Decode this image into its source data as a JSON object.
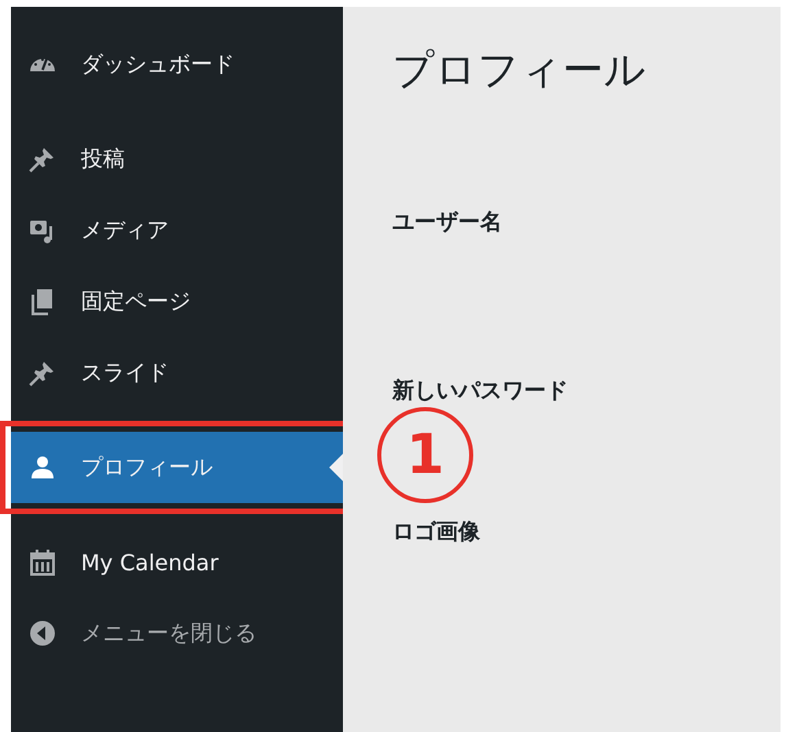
{
  "sidebar": {
    "groups": [
      [
        {
          "label": "ダッシュボード",
          "selected": false,
          "kind": "menu"
        }
      ],
      [
        {
          "label": "投稿",
          "selected": false,
          "kind": "menu"
        },
        {
          "label": "メディア",
          "selected": false,
          "kind": "menu"
        },
        {
          "label": "固定ページ",
          "selected": false,
          "kind": "menu"
        },
        {
          "label": "スライド",
          "selected": false,
          "kind": "menu"
        }
      ],
      [
        {
          "label": "プロフィール",
          "selected": true,
          "kind": "menu"
        }
      ],
      [
        {
          "label": "My Calendar",
          "selected": false,
          "kind": "menu"
        },
        {
          "label": "メニューを閉じる",
          "selected": false,
          "kind": "collapse"
        }
      ]
    ]
  },
  "page": {
    "title": "プロフィール",
    "fields": [
      "ユーザー名",
      "新しいパスワード",
      "ロゴ画像"
    ]
  },
  "annotation": {
    "marker": "1"
  }
}
